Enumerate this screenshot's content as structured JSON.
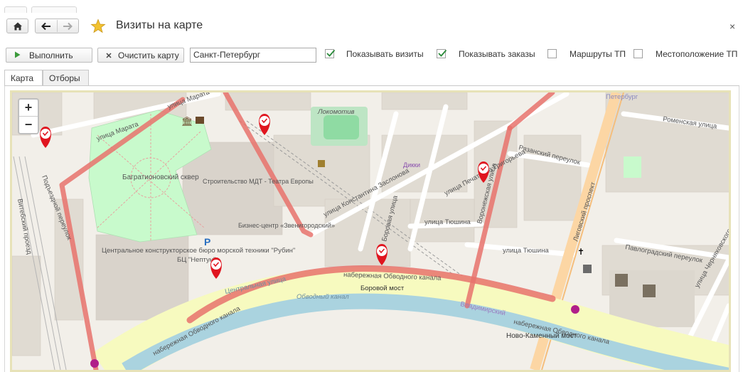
{
  "window": {
    "title": "Визиты на карте",
    "close_glyph": "×"
  },
  "nav": {
    "home_icon": "home-icon",
    "back_icon": "arrow-left-icon",
    "forward_icon": "arrow-right-icon",
    "favorite_icon": "star-icon"
  },
  "toolbar": {
    "run_label": "Выполнить",
    "clear_label": "Очистить карту",
    "city_value": "Санкт-Петербург",
    "show_visits_label": "Показывать визиты",
    "show_visits_checked": true,
    "show_orders_label": "Показывать заказы",
    "show_orders_checked": true,
    "routes_label": "Маршруты ТП",
    "routes_checked": false,
    "location_label": "Местоположение ТП",
    "location_checked": false
  },
  "tabs": [
    {
      "label": "Карта",
      "active": true
    },
    {
      "label": "Отборы",
      "active": false
    }
  ],
  "map": {
    "zoom_in": "+",
    "zoom_out": "−",
    "colors": {
      "route": "#e8726c",
      "water": "#aad3df",
      "park": "#c8facc",
      "marker": "#e0151f"
    },
    "labels": {
      "marata1": "улица Марата",
      "marata2": "улица Марата",
      "podezdnoy": "Подъездной переулок",
      "vitebsky": "Витебский проезд",
      "bagration": "Багратионовский сквер",
      "stroitelstvo": "Строительство МДТ - Театра Европы",
      "business": "Бизнес-центр «Звенигородский»",
      "rubin": "Центральное конструкторское бюро морской техники \"Рубин\"",
      "bc_nept": "БЦ \"Нептун\"",
      "lokomotiv": "Локомотив",
      "zaslonova": "улица Константина Заслонова",
      "pechatnika": "улица Печатника Григорьева",
      "dikki": "Дикки",
      "tyushina1": "улица Тюшина",
      "tyushina2": "улица Тюшина",
      "borovaya": "Боровая улица",
      "voronezhskaya": "Воронежская улица",
      "ryazansky": "Рязанский переулок",
      "ligovsky": "Лиговский проспект",
      "pavlogradsky": "Павлоградский переулок",
      "romenskaya": "Роменская улица",
      "chernyakhovskogo": "улица Черняховского",
      "petersburg": "Петербург",
      "naberezhnaya": "набережная Обводного канала",
      "borovoy_most": "Боровой мост",
      "novo_kamenny": "Ново-Каменный мост",
      "obvodny": "Обводный канал",
      "tsentralnaya": "Центральная улица",
      "vladimirsky": "Владимирский"
    }
  }
}
